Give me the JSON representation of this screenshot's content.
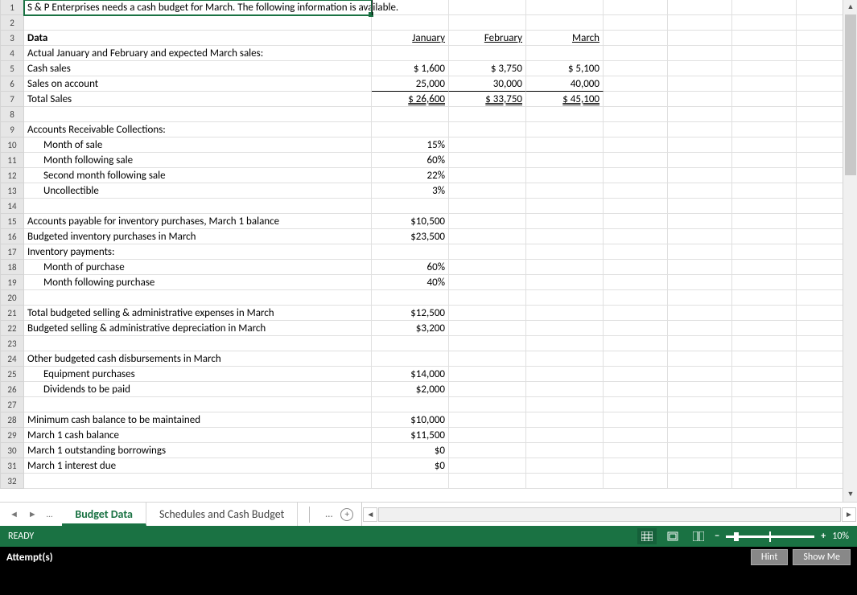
{
  "rows": [
    {
      "n": 1,
      "a": "S & P Enterprises needs a cash budget for March. The following information is available.",
      "a_sel": true
    },
    {
      "n": 2,
      "a": ""
    },
    {
      "n": 3,
      "a": "Data",
      "a_cls": "bold",
      "b": "January",
      "c": "February",
      "d": "March",
      "bcd_cls": "underline right"
    },
    {
      "n": 4,
      "a": "Actual January and February and expected March sales:"
    },
    {
      "n": 5,
      "a": "Cash sales",
      "b": "$     1,600",
      "c": "$     3,750",
      "d": "$     5,100",
      "bcd_cls": "right"
    },
    {
      "n": 6,
      "a": "Sales on account",
      "b": "25,000",
      "c": "30,000",
      "d": "40,000",
      "bcd_cls": "right border-bottom-single"
    },
    {
      "n": 7,
      "a": "Total Sales",
      "b": "$   26,600",
      "c": "$   33,750",
      "d": "$  45,100",
      "bcd_cls": "right double-underline"
    },
    {
      "n": 8,
      "a": ""
    },
    {
      "n": 9,
      "a": "Accounts Receivable Collections:"
    },
    {
      "n": 10,
      "a": "Month of sale",
      "a_cls": "indent1",
      "b": "15%",
      "bcd_cls": "right"
    },
    {
      "n": 11,
      "a": "Month following sale",
      "a_cls": "indent1",
      "b": "60%",
      "bcd_cls": "right"
    },
    {
      "n": 12,
      "a": "Second month following sale",
      "a_cls": "indent1",
      "b": "22%",
      "bcd_cls": "right"
    },
    {
      "n": 13,
      "a": "Uncollectible",
      "a_cls": "indent1",
      "b": "3%",
      "bcd_cls": "right"
    },
    {
      "n": 14,
      "a": ""
    },
    {
      "n": 15,
      "a": "Accounts payable for inventory purchases, March 1 balance",
      "b": "$10,500",
      "bcd_cls": "right"
    },
    {
      "n": 16,
      "a": "Budgeted inventory purchases in March",
      "b": "$23,500",
      "bcd_cls": "right"
    },
    {
      "n": 17,
      "a": "Inventory payments:"
    },
    {
      "n": 18,
      "a": "Month of purchase",
      "a_cls": "indent1",
      "b": "60%",
      "bcd_cls": "right"
    },
    {
      "n": 19,
      "a": "Month following purchase",
      "a_cls": "indent1",
      "b": "40%",
      "bcd_cls": "right"
    },
    {
      "n": 20,
      "a": ""
    },
    {
      "n": 21,
      "a": "Total budgeted selling & administrative expenses in March",
      "b": "$12,500",
      "bcd_cls": "right"
    },
    {
      "n": 22,
      "a": "Budgeted selling & administrative depreciation in March",
      "b": "$3,200",
      "bcd_cls": "right"
    },
    {
      "n": 23,
      "a": ""
    },
    {
      "n": 24,
      "a": "Other budgeted cash disbursements in March"
    },
    {
      "n": 25,
      "a": "Equipment purchases",
      "a_cls": "indent1",
      "b": "$14,000",
      "bcd_cls": "right"
    },
    {
      "n": 26,
      "a": "Dividends to be paid",
      "a_cls": "indent1",
      "b": "$2,000",
      "bcd_cls": "right"
    },
    {
      "n": 27,
      "a": ""
    },
    {
      "n": 28,
      "a": "Minimum cash balance to be maintained",
      "b": "$10,000",
      "bcd_cls": "right"
    },
    {
      "n": 29,
      "a": "March 1 cash balance",
      "b": "$11,500",
      "bcd_cls": "right"
    },
    {
      "n": 30,
      "a": "March 1 outstanding borrowings",
      "b": "$0",
      "bcd_cls": "right"
    },
    {
      "n": 31,
      "a": "March 1 interest due",
      "b": "$0",
      "bcd_cls": "right"
    },
    {
      "n": 32,
      "a": ""
    }
  ],
  "tabs": {
    "active": "Budget Data",
    "other": "Schedules and Cash Budget"
  },
  "status": {
    "ready": "READY",
    "zoom": "10%"
  },
  "attempts": {
    "label": "Attempt(s)",
    "hint": "Hint",
    "showme": "Show Me"
  }
}
